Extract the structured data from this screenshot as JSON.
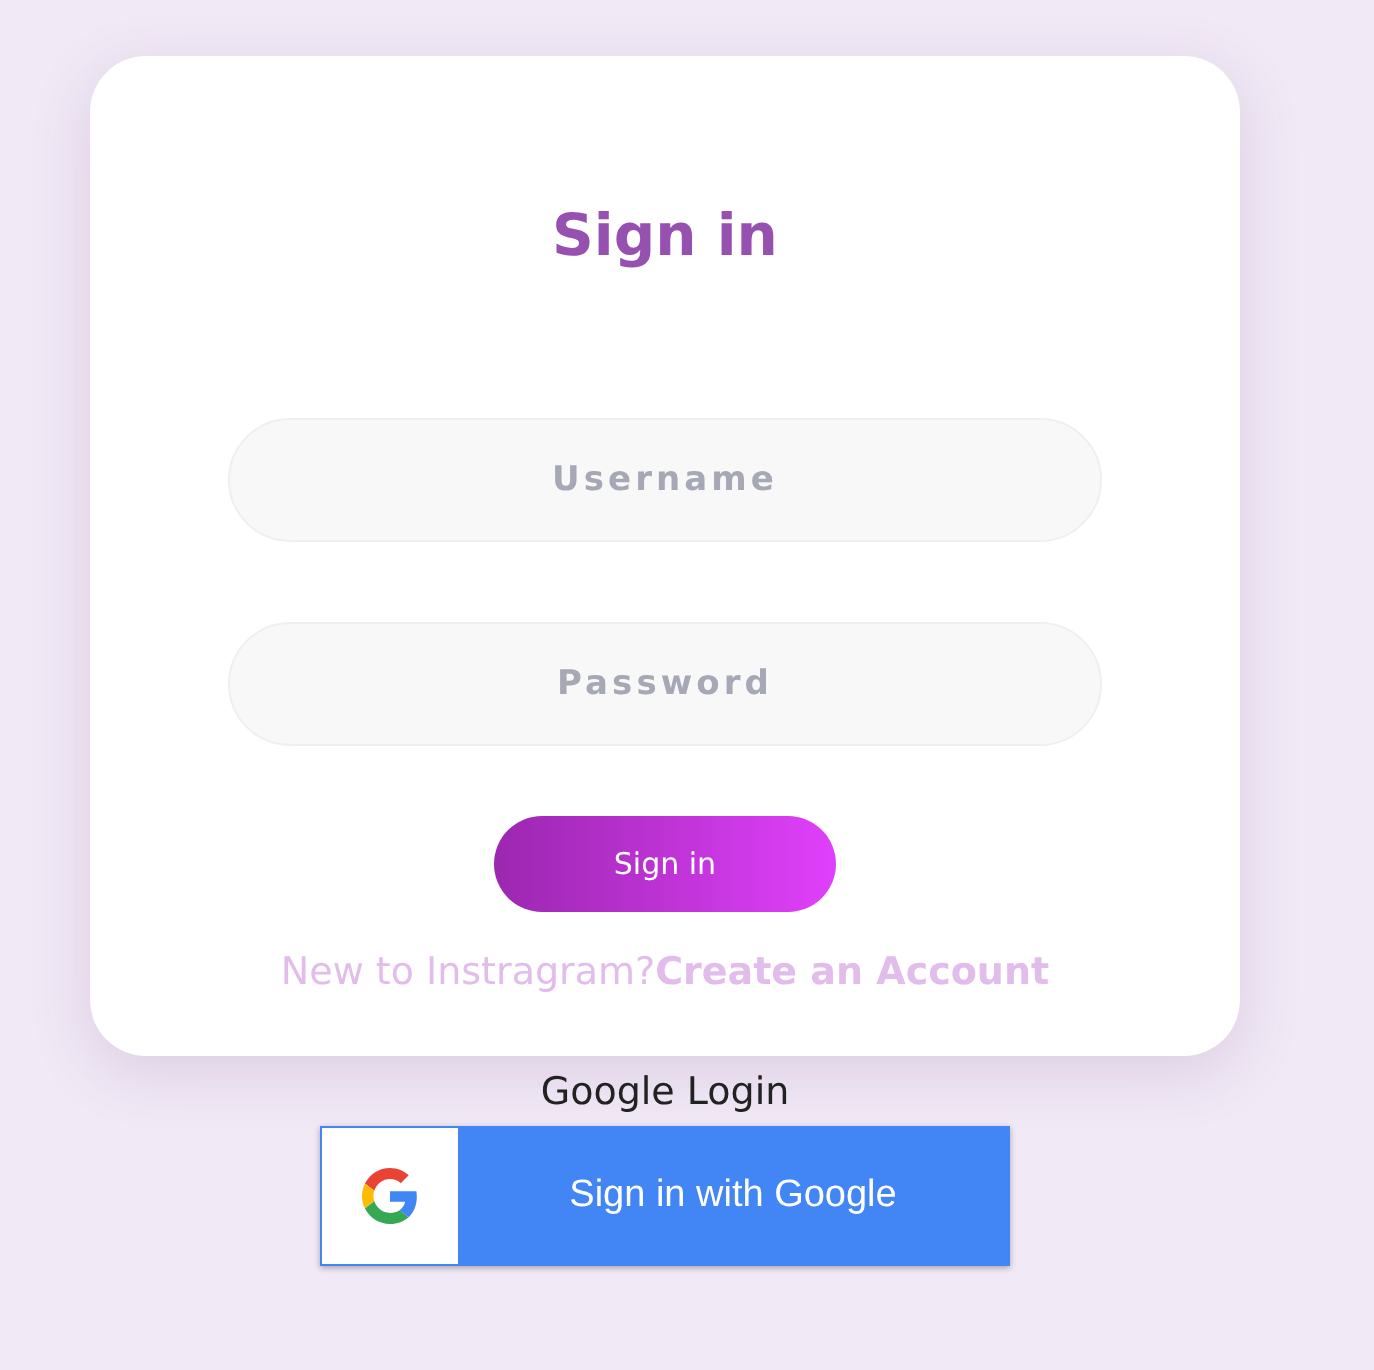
{
  "card": {
    "title": "Sign in",
    "fields": [
      {
        "placeholder": "Username"
      },
      {
        "placeholder": "Password"
      }
    ],
    "submit": "Sign in",
    "footer": {
      "text": "New to Instragram?",
      "link": "Create an Account"
    }
  },
  "google": {
    "heading": "Google Login",
    "button": "Sign in with Google"
  }
}
